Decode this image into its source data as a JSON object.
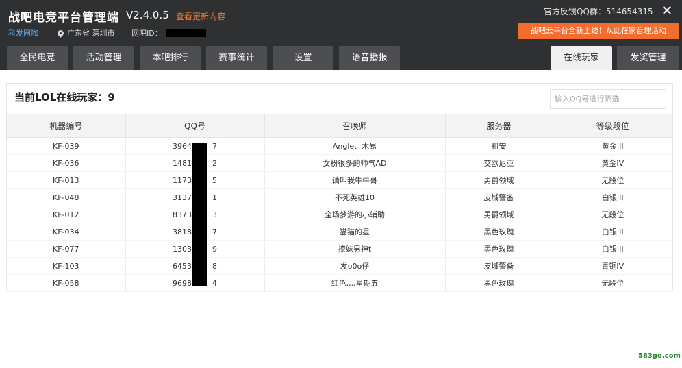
{
  "header": {
    "app_title": "战吧电竞平台管理端",
    "version": "V2.4.0.5",
    "update_link": "查看更新内容",
    "cafe_name": "科发网咖",
    "location": "广东省 深圳市",
    "cafe_id_label": "网吧ID：",
    "qq_group": "官方反馈QQ群：514654315",
    "close_glyph": "✕",
    "promo": "战吧云平台全新上线！从此在家管理活动"
  },
  "tabs": [
    {
      "label": "全民电竞"
    },
    {
      "label": "活动管理"
    },
    {
      "label": "本吧排行"
    },
    {
      "label": "赛事统计"
    },
    {
      "label": "设置"
    },
    {
      "label": "语音播报"
    },
    {
      "label": "在线玩家",
      "active": true
    },
    {
      "label": "发奖管理"
    }
  ],
  "online": {
    "title": "当前LOL在线玩家：9",
    "filter_placeholder": "输入QQ号进行筛选"
  },
  "table": {
    "headers": [
      "机器编号",
      "QQ号",
      "召唤师",
      "服务器",
      "等级段位"
    ],
    "rows": [
      {
        "machine": "KF-039",
        "qq": "3964",
        "qq_tail": "7",
        "name": "Angle、木易",
        "server": "祖安",
        "rank": "黄金III"
      },
      {
        "machine": "KF-036",
        "qq": "1481",
        "qq_tail": "2",
        "name": "女粉很多的帅气AD",
        "server": "艾欧尼亚",
        "rank": "黄金IV"
      },
      {
        "machine": "KF-013",
        "qq": "1173",
        "qq_tail": "5",
        "name": "请叫我牛牛哥",
        "server": "男爵领域",
        "rank": "无段位"
      },
      {
        "machine": "KF-048",
        "qq": "3137",
        "qq_tail": "1",
        "name": "不死英雄10",
        "server": "皮城警备",
        "rank": "白银III"
      },
      {
        "machine": "KF-012",
        "qq": "8373",
        "qq_tail": "3",
        "name": "全场梦游的小辅助",
        "server": "男爵领域",
        "rank": "无段位"
      },
      {
        "machine": "KF-034",
        "qq": "3818",
        "qq_tail": "7",
        "name": "猫猫的星",
        "server": "黑色玫瑰",
        "rank": "白银III"
      },
      {
        "machine": "KF-077",
        "qq": "1303",
        "qq_tail": "9",
        "name": "撩妹男神t",
        "server": "黑色玫瑰",
        "rank": "白银III"
      },
      {
        "machine": "KF-103",
        "qq": "6453",
        "qq_tail": "8",
        "name": "发o0o仔",
        "server": "皮城警备",
        "rank": "青铜IV"
      },
      {
        "machine": "KF-058",
        "qq": "9698",
        "qq_tail": "4",
        "name": "红色,,,,星期五",
        "server": "黑色玫瑰",
        "rank": "无段位"
      }
    ]
  },
  "watermark": "583go.com",
  "colors": {
    "header_bg": "#2f3032",
    "tab_bg": "#4d4e51",
    "accent_orange": "#f26d2e",
    "link_blue": "#64a9e6"
  }
}
